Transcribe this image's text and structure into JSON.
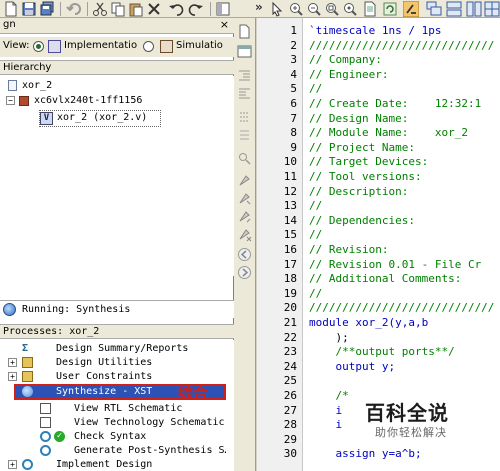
{
  "toolbar": {
    "icons": [
      "new-file-icon",
      "save-icon",
      "save-all-icon",
      "cut-icon",
      "copy-icon",
      "paste-icon",
      "delete-icon",
      "undo-icon",
      "redo-icon",
      "more-chevron-icon",
      "zoom-in-icon",
      "zoom-out-icon",
      "zoom-full-icon",
      "zoom-fit-icon",
      "refresh-icon",
      "compile-icon",
      "cascade-icon",
      "tile-icon",
      "split-icon"
    ],
    "chevron": "»"
  },
  "design_panel": {
    "tab_label": "gn",
    "close_glyph": "×",
    "view_label": "View:",
    "view_options": [
      "Implementatio",
      "Simulatio"
    ],
    "selected_view": "Implementation",
    "hierarchy_label": "Hierarchy",
    "tree": [
      {
        "label": "xor_2",
        "level": 1
      },
      {
        "label": "xc6vlx240t-1ff1156",
        "level": 1
      },
      {
        "label": "xor_2 (xor_2.v)",
        "level": 2,
        "file_tag": "V"
      }
    ]
  },
  "status": {
    "running_text": "Running: Synthesis"
  },
  "processes": {
    "header": "Processes: xor_2",
    "items": [
      {
        "label": "Design Summary/Reports",
        "icon": "summary-icon"
      },
      {
        "label": "Design Utilities",
        "icon": "folder-icon"
      },
      {
        "label": "User Constraints",
        "icon": "folder-icon"
      },
      {
        "label": "Synthesize - XST",
        "icon": "synthesize-icon",
        "highlighted": true
      },
      {
        "label": "View RTL Schematic",
        "icon": "schematic-icon"
      },
      {
        "label": "View Technology Schematic",
        "icon": "schematic-icon"
      },
      {
        "label": "Check Syntax",
        "icon": "check-icon"
      },
      {
        "label": "Generate Post-Synthesis S…",
        "icon": "generate-icon"
      },
      {
        "label": "Implement Design",
        "icon": "implement-icon"
      }
    ],
    "annotation": "综合"
  },
  "editor": {
    "line_numbers": [
      "1",
      "2",
      "3",
      "4",
      "5",
      "6",
      "7",
      "8",
      "9",
      "10",
      "11",
      "12",
      "13",
      "14",
      "15",
      "16",
      "17",
      "18",
      "19",
      "20",
      "21",
      "22",
      "23",
      "24",
      "25",
      "26",
      "27",
      "28",
      "29",
      "30"
    ],
    "lines": [
      {
        "text": "`timescale 1ns / 1ps",
        "style": "kw"
      },
      {
        "text": "////////////////////////////",
        "style": "cm"
      },
      {
        "text": "// Company:",
        "style": "cm"
      },
      {
        "text": "// Engineer:",
        "style": "cm"
      },
      {
        "text": "//",
        "style": "cm"
      },
      {
        "text": "// Create Date:    12:32:1",
        "style": "cm"
      },
      {
        "text": "// Design Name:",
        "style": "cm"
      },
      {
        "text": "// Module Name:    xor_2",
        "style": "cm"
      },
      {
        "text": "// Project Name:",
        "style": "cm"
      },
      {
        "text": "// Target Devices:",
        "style": "cm"
      },
      {
        "text": "// Tool versions:",
        "style": "cm"
      },
      {
        "text": "// Description:",
        "style": "cm"
      },
      {
        "text": "//",
        "style": "cm"
      },
      {
        "text": "// Dependencies:",
        "style": "cm"
      },
      {
        "text": "//",
        "style": "cm"
      },
      {
        "text": "// Revision:",
        "style": "cm"
      },
      {
        "text": "// Revision 0.01 - File Cr",
        "style": "cm"
      },
      {
        "text": "// Additional Comments:",
        "style": "cm"
      },
      {
        "text": "//",
        "style": "cm"
      },
      {
        "text": "////////////////////////////",
        "style": "cm"
      },
      {
        "text": "module xor_2(y,a,b",
        "style": "kw"
      },
      {
        "text": "    );",
        "style": "ctx"
      },
      {
        "text": "    /**output ports**/",
        "style": "cm"
      },
      {
        "text": "    output y;",
        "style": "kw"
      },
      {
        "text": "",
        "style": "ctx"
      },
      {
        "text": "    /*",
        "style": "cm"
      },
      {
        "text": "    i",
        "style": "kw"
      },
      {
        "text": "    i",
        "style": "kw"
      },
      {
        "text": "",
        "style": "ctx"
      },
      {
        "text": "    assign y=a^b;",
        "style": "kw"
      }
    ]
  },
  "watermark": {
    "title": "百科全说",
    "subtitle": "助你轻松解决"
  }
}
